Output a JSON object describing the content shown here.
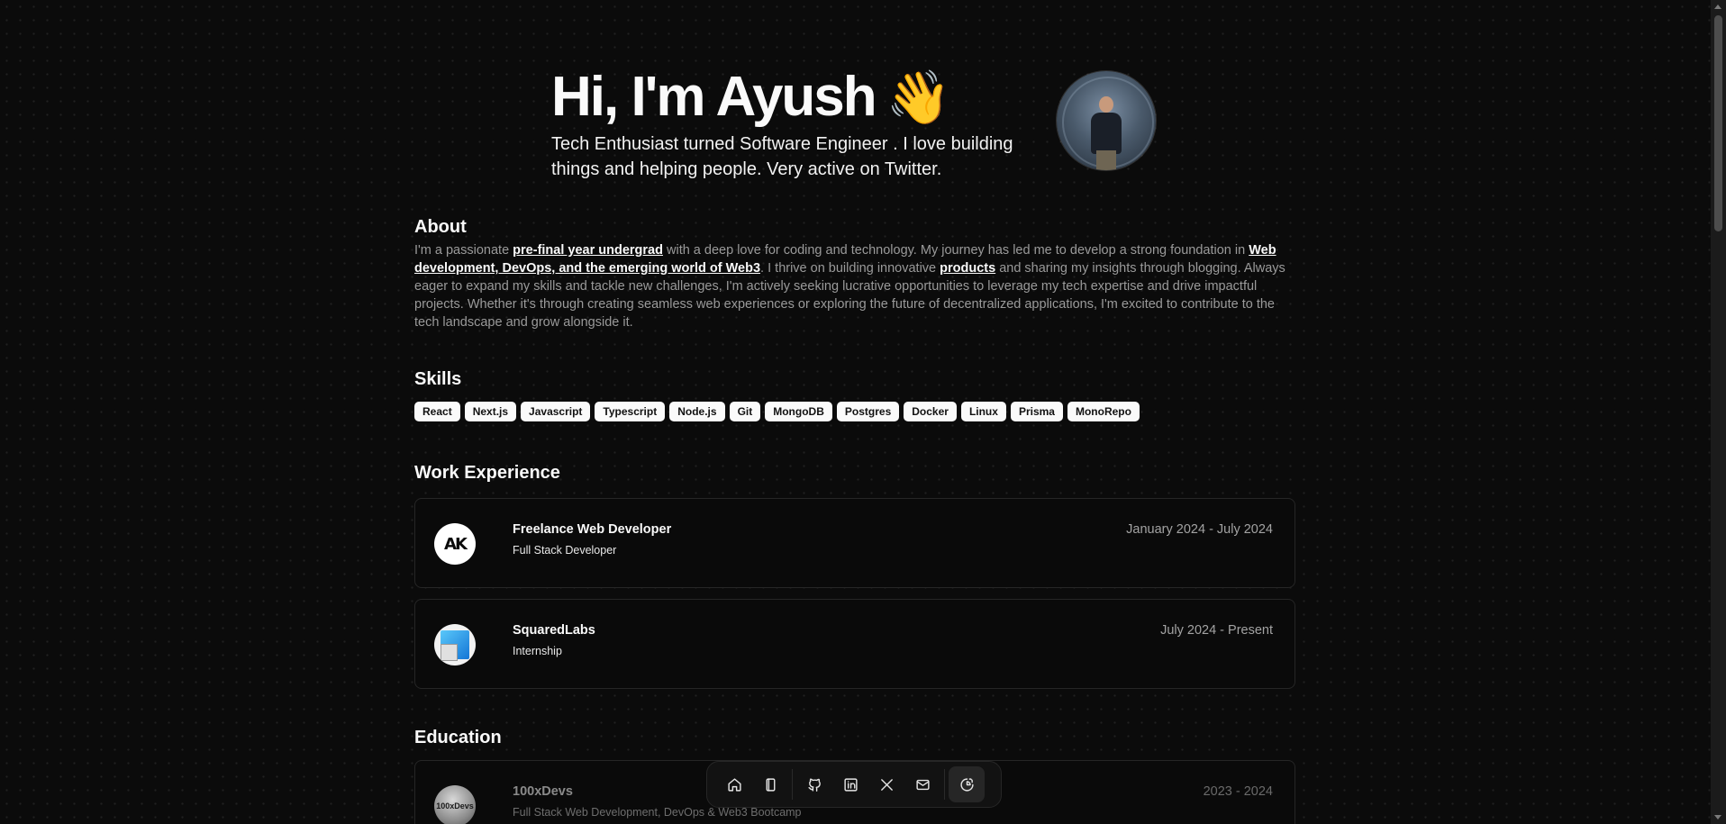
{
  "hero": {
    "greeting": "Hi, I'm Ayush",
    "wave_emoji": "👋",
    "tagline": "Tech Enthusiast turned Software Engineer . I love building things and helping people. Very active on Twitter."
  },
  "about": {
    "title": "About",
    "text_1": "I'm a passionate ",
    "link_1": "pre-final year undergrad",
    "text_2": " with a deep love for coding and technology. My journey has led me to develop a strong foundation in ",
    "link_2": "Web development, DevOps, and the emerging world of Web3",
    "text_3": ". I thrive on building innovative ",
    "link_3": "products",
    "text_4": " and sharing my insights through blogging. Always eager to expand my skills and tackle new challenges, I'm actively seeking lucrative opportunities to leverage my tech expertise and drive impactful projects. Whether it's through creating seamless web experiences or exploring the future of decentralized applications, I'm excited to contribute to the tech landscape and grow alongside it."
  },
  "skills": {
    "title": "Skills",
    "items": [
      "React",
      "Next.js",
      "Javascript",
      "Typescript",
      "Node.js",
      "Git",
      "MongoDB",
      "Postgres",
      "Docker",
      "Linux",
      "Prisma",
      "MonoRepo"
    ]
  },
  "work": {
    "title": "Work Experience",
    "items": [
      {
        "logo": "AK",
        "company": "Freelance Web Developer",
        "role": "Full Stack Developer",
        "dates": "January 2024 - July 2024"
      },
      {
        "logo": "",
        "company": "SquaredLabs",
        "role": "Internship",
        "dates": "July 2024 - Present"
      }
    ]
  },
  "education": {
    "title": "Education",
    "items": [
      {
        "logo": "100xDevs",
        "school": "100xDevs",
        "program": "Full Stack Web Development, DevOps & Web3 Bootcamp",
        "dates": "2023 - 2024"
      }
    ]
  },
  "dock": {
    "items": [
      "home-icon",
      "notebook-icon",
      "github-icon",
      "linkedin-icon",
      "x-icon",
      "mail-icon",
      "theme-toggle-icon"
    ]
  },
  "colors": {
    "background": "#0b0b0b",
    "text": "#fafafa",
    "muted": "#9a9a9a",
    "border": "#262626"
  }
}
